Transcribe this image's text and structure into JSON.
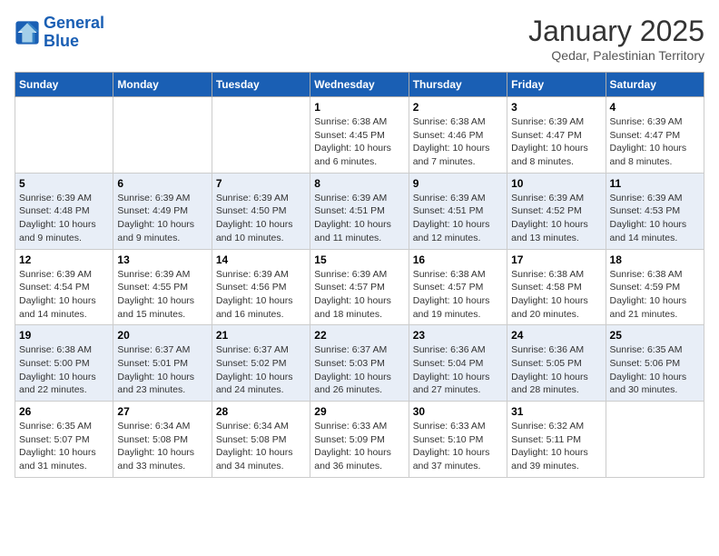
{
  "logo": {
    "line1": "General",
    "line2": "Blue"
  },
  "title": "January 2025",
  "location": "Qedar, Palestinian Territory",
  "weekdays": [
    "Sunday",
    "Monday",
    "Tuesday",
    "Wednesday",
    "Thursday",
    "Friday",
    "Saturday"
  ],
  "weeks": [
    [
      {
        "day": "",
        "info": ""
      },
      {
        "day": "",
        "info": ""
      },
      {
        "day": "",
        "info": ""
      },
      {
        "day": "1",
        "info": "Sunrise: 6:38 AM\nSunset: 4:45 PM\nDaylight: 10 hours\nand 6 minutes."
      },
      {
        "day": "2",
        "info": "Sunrise: 6:38 AM\nSunset: 4:46 PM\nDaylight: 10 hours\nand 7 minutes."
      },
      {
        "day": "3",
        "info": "Sunrise: 6:39 AM\nSunset: 4:47 PM\nDaylight: 10 hours\nand 8 minutes."
      },
      {
        "day": "4",
        "info": "Sunrise: 6:39 AM\nSunset: 4:47 PM\nDaylight: 10 hours\nand 8 minutes."
      }
    ],
    [
      {
        "day": "5",
        "info": "Sunrise: 6:39 AM\nSunset: 4:48 PM\nDaylight: 10 hours\nand 9 minutes."
      },
      {
        "day": "6",
        "info": "Sunrise: 6:39 AM\nSunset: 4:49 PM\nDaylight: 10 hours\nand 9 minutes."
      },
      {
        "day": "7",
        "info": "Sunrise: 6:39 AM\nSunset: 4:50 PM\nDaylight: 10 hours\nand 10 minutes."
      },
      {
        "day": "8",
        "info": "Sunrise: 6:39 AM\nSunset: 4:51 PM\nDaylight: 10 hours\nand 11 minutes."
      },
      {
        "day": "9",
        "info": "Sunrise: 6:39 AM\nSunset: 4:51 PM\nDaylight: 10 hours\nand 12 minutes."
      },
      {
        "day": "10",
        "info": "Sunrise: 6:39 AM\nSunset: 4:52 PM\nDaylight: 10 hours\nand 13 minutes."
      },
      {
        "day": "11",
        "info": "Sunrise: 6:39 AM\nSunset: 4:53 PM\nDaylight: 10 hours\nand 14 minutes."
      }
    ],
    [
      {
        "day": "12",
        "info": "Sunrise: 6:39 AM\nSunset: 4:54 PM\nDaylight: 10 hours\nand 14 minutes."
      },
      {
        "day": "13",
        "info": "Sunrise: 6:39 AM\nSunset: 4:55 PM\nDaylight: 10 hours\nand 15 minutes."
      },
      {
        "day": "14",
        "info": "Sunrise: 6:39 AM\nSunset: 4:56 PM\nDaylight: 10 hours\nand 16 minutes."
      },
      {
        "day": "15",
        "info": "Sunrise: 6:39 AM\nSunset: 4:57 PM\nDaylight: 10 hours\nand 18 minutes."
      },
      {
        "day": "16",
        "info": "Sunrise: 6:38 AM\nSunset: 4:57 PM\nDaylight: 10 hours\nand 19 minutes."
      },
      {
        "day": "17",
        "info": "Sunrise: 6:38 AM\nSunset: 4:58 PM\nDaylight: 10 hours\nand 20 minutes."
      },
      {
        "day": "18",
        "info": "Sunrise: 6:38 AM\nSunset: 4:59 PM\nDaylight: 10 hours\nand 21 minutes."
      }
    ],
    [
      {
        "day": "19",
        "info": "Sunrise: 6:38 AM\nSunset: 5:00 PM\nDaylight: 10 hours\nand 22 minutes."
      },
      {
        "day": "20",
        "info": "Sunrise: 6:37 AM\nSunset: 5:01 PM\nDaylight: 10 hours\nand 23 minutes."
      },
      {
        "day": "21",
        "info": "Sunrise: 6:37 AM\nSunset: 5:02 PM\nDaylight: 10 hours\nand 24 minutes."
      },
      {
        "day": "22",
        "info": "Sunrise: 6:37 AM\nSunset: 5:03 PM\nDaylight: 10 hours\nand 26 minutes."
      },
      {
        "day": "23",
        "info": "Sunrise: 6:36 AM\nSunset: 5:04 PM\nDaylight: 10 hours\nand 27 minutes."
      },
      {
        "day": "24",
        "info": "Sunrise: 6:36 AM\nSunset: 5:05 PM\nDaylight: 10 hours\nand 28 minutes."
      },
      {
        "day": "25",
        "info": "Sunrise: 6:35 AM\nSunset: 5:06 PM\nDaylight: 10 hours\nand 30 minutes."
      }
    ],
    [
      {
        "day": "26",
        "info": "Sunrise: 6:35 AM\nSunset: 5:07 PM\nDaylight: 10 hours\nand 31 minutes."
      },
      {
        "day": "27",
        "info": "Sunrise: 6:34 AM\nSunset: 5:08 PM\nDaylight: 10 hours\nand 33 minutes."
      },
      {
        "day": "28",
        "info": "Sunrise: 6:34 AM\nSunset: 5:08 PM\nDaylight: 10 hours\nand 34 minutes."
      },
      {
        "day": "29",
        "info": "Sunrise: 6:33 AM\nSunset: 5:09 PM\nDaylight: 10 hours\nand 36 minutes."
      },
      {
        "day": "30",
        "info": "Sunrise: 6:33 AM\nSunset: 5:10 PM\nDaylight: 10 hours\nand 37 minutes."
      },
      {
        "day": "31",
        "info": "Sunrise: 6:32 AM\nSunset: 5:11 PM\nDaylight: 10 hours\nand 39 minutes."
      },
      {
        "day": "",
        "info": ""
      }
    ]
  ]
}
